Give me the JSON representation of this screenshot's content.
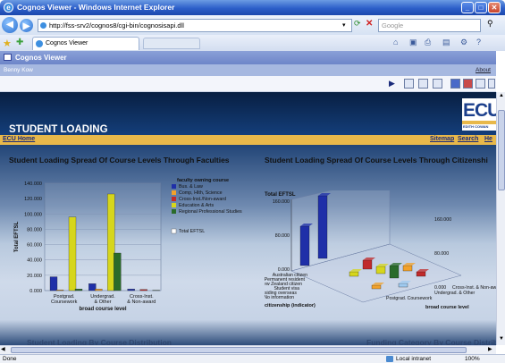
{
  "window": {
    "title": "Cognos Viewer - Windows Internet Explorer",
    "icon": "ie-icon"
  },
  "address": {
    "url": "http://fss-srv2/cognos8/cgi-bin/cognosisapi.dll",
    "search_placeholder": "Google"
  },
  "tabs": [
    {
      "label": "Cognos Viewer"
    }
  ],
  "viewer": {
    "title": "Cognos Viewer",
    "user": "Benny Kow",
    "about": "About"
  },
  "report": {
    "title": "STUDENT LOADING",
    "home_link": "ECU Home",
    "nav_links": [
      "Sitemap",
      "Search",
      "He"
    ],
    "logo": {
      "text": "ECU",
      "sub": "EDITH COWAN"
    },
    "section_left": "Student Loading Spread Of Course Levels Through Faculties",
    "section_right": "Student Loading Spread Of Course Levels Through Citizenshi",
    "bottom_left": "Student Loading By Course Distribution",
    "bottom_right": "Funding Category By Course Distributio"
  },
  "chart_data": [
    {
      "type": "bar",
      "ylabel": "Total EFTSL",
      "xlabel": "broad course level",
      "yticks": [
        "0.000",
        "20.000",
        "40.000",
        "60.000",
        "80.000",
        "100.000",
        "120.000",
        "140.000"
      ],
      "ylim": [
        0,
        140000
      ],
      "categories": [
        "Postgrad. Coursework",
        "Undergrad. & Other",
        "Cross-Inst. & Non-award"
      ],
      "legend_title": "faculty owning course",
      "legend_position": "right",
      "series": [
        {
          "name": "Bus. & Law",
          "color": "#1f2fa8",
          "values": [
            18000,
            9000,
            2000
          ]
        },
        {
          "name": "Comp, HIth, Science",
          "color": "#f2a12a",
          "values": [
            1000,
            2000,
            0
          ]
        },
        {
          "name": "Cross-Inst./Non-award",
          "color": "#c02a2a",
          "values": [
            0,
            0,
            1500
          ]
        },
        {
          "name": "Education & Arts",
          "color": "#d6d61c",
          "values": [
            96000,
            126000,
            0
          ]
        },
        {
          "name": "Regional Professional Studies",
          "color": "#2a6b2a",
          "values": [
            2000,
            49000,
            500
          ]
        }
      ],
      "legend_extra": "Total EFTSL"
    },
    {
      "type": "bar",
      "ylabel": "Total EFTSL",
      "xlabel": "broad course level",
      "x2label": "citizenship (indicator)",
      "yticks": [
        "0.000",
        "80.000",
        "160.000"
      ],
      "right_ticks": [
        "0.000",
        "80.000",
        "160.000"
      ],
      "categories": [
        "Postgrad. Coursework",
        "Undergrad. & Other",
        "Cross-Inst. & Non-award"
      ],
      "citizenship": [
        "Australian citizen",
        "Permanent resident",
        "New Zealand citizen",
        "Student visa",
        "Residing overseas",
        "No information"
      ]
    }
  ],
  "status": {
    "left": "Done",
    "zone": "Local intranet",
    "zoom": "100%"
  }
}
